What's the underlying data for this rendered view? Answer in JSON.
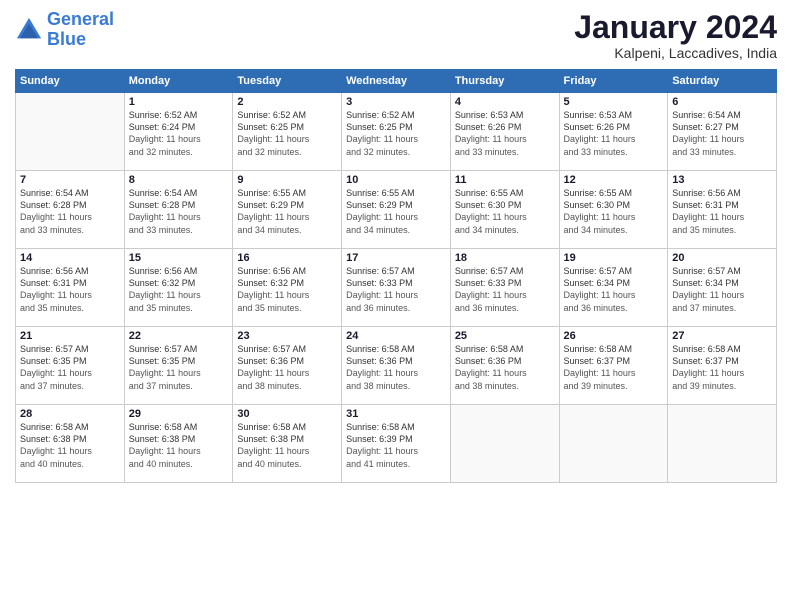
{
  "logo": {
    "line1": "General",
    "line2": "Blue"
  },
  "title": "January 2024",
  "location": "Kalpeni, Laccadives, India",
  "days_of_week": [
    "Sunday",
    "Monday",
    "Tuesday",
    "Wednesday",
    "Thursday",
    "Friday",
    "Saturday"
  ],
  "weeks": [
    [
      {
        "day": "",
        "sunrise": "",
        "sunset": "",
        "daylight": ""
      },
      {
        "day": "1",
        "sunrise": "Sunrise: 6:52 AM",
        "sunset": "Sunset: 6:24 PM",
        "daylight": "Daylight: 11 hours and 32 minutes."
      },
      {
        "day": "2",
        "sunrise": "Sunrise: 6:52 AM",
        "sunset": "Sunset: 6:25 PM",
        "daylight": "Daylight: 11 hours and 32 minutes."
      },
      {
        "day": "3",
        "sunrise": "Sunrise: 6:52 AM",
        "sunset": "Sunset: 6:25 PM",
        "daylight": "Daylight: 11 hours and 32 minutes."
      },
      {
        "day": "4",
        "sunrise": "Sunrise: 6:53 AM",
        "sunset": "Sunset: 6:26 PM",
        "daylight": "Daylight: 11 hours and 33 minutes."
      },
      {
        "day": "5",
        "sunrise": "Sunrise: 6:53 AM",
        "sunset": "Sunset: 6:26 PM",
        "daylight": "Daylight: 11 hours and 33 minutes."
      },
      {
        "day": "6",
        "sunrise": "Sunrise: 6:54 AM",
        "sunset": "Sunset: 6:27 PM",
        "daylight": "Daylight: 11 hours and 33 minutes."
      }
    ],
    [
      {
        "day": "7",
        "sunrise": "Sunrise: 6:54 AM",
        "sunset": "Sunset: 6:28 PM",
        "daylight": "Daylight: 11 hours and 33 minutes."
      },
      {
        "day": "8",
        "sunrise": "Sunrise: 6:54 AM",
        "sunset": "Sunset: 6:28 PM",
        "daylight": "Daylight: 11 hours and 33 minutes."
      },
      {
        "day": "9",
        "sunrise": "Sunrise: 6:55 AM",
        "sunset": "Sunset: 6:29 PM",
        "daylight": "Daylight: 11 hours and 34 minutes."
      },
      {
        "day": "10",
        "sunrise": "Sunrise: 6:55 AM",
        "sunset": "Sunset: 6:29 PM",
        "daylight": "Daylight: 11 hours and 34 minutes."
      },
      {
        "day": "11",
        "sunrise": "Sunrise: 6:55 AM",
        "sunset": "Sunset: 6:30 PM",
        "daylight": "Daylight: 11 hours and 34 minutes."
      },
      {
        "day": "12",
        "sunrise": "Sunrise: 6:55 AM",
        "sunset": "Sunset: 6:30 PM",
        "daylight": "Daylight: 11 hours and 34 minutes."
      },
      {
        "day": "13",
        "sunrise": "Sunrise: 6:56 AM",
        "sunset": "Sunset: 6:31 PM",
        "daylight": "Daylight: 11 hours and 35 minutes."
      }
    ],
    [
      {
        "day": "14",
        "sunrise": "Sunrise: 6:56 AM",
        "sunset": "Sunset: 6:31 PM",
        "daylight": "Daylight: 11 hours and 35 minutes."
      },
      {
        "day": "15",
        "sunrise": "Sunrise: 6:56 AM",
        "sunset": "Sunset: 6:32 PM",
        "daylight": "Daylight: 11 hours and 35 minutes."
      },
      {
        "day": "16",
        "sunrise": "Sunrise: 6:56 AM",
        "sunset": "Sunset: 6:32 PM",
        "daylight": "Daylight: 11 hours and 35 minutes."
      },
      {
        "day": "17",
        "sunrise": "Sunrise: 6:57 AM",
        "sunset": "Sunset: 6:33 PM",
        "daylight": "Daylight: 11 hours and 36 minutes."
      },
      {
        "day": "18",
        "sunrise": "Sunrise: 6:57 AM",
        "sunset": "Sunset: 6:33 PM",
        "daylight": "Daylight: 11 hours and 36 minutes."
      },
      {
        "day": "19",
        "sunrise": "Sunrise: 6:57 AM",
        "sunset": "Sunset: 6:34 PM",
        "daylight": "Daylight: 11 hours and 36 minutes."
      },
      {
        "day": "20",
        "sunrise": "Sunrise: 6:57 AM",
        "sunset": "Sunset: 6:34 PM",
        "daylight": "Daylight: 11 hours and 37 minutes."
      }
    ],
    [
      {
        "day": "21",
        "sunrise": "Sunrise: 6:57 AM",
        "sunset": "Sunset: 6:35 PM",
        "daylight": "Daylight: 11 hours and 37 minutes."
      },
      {
        "day": "22",
        "sunrise": "Sunrise: 6:57 AM",
        "sunset": "Sunset: 6:35 PM",
        "daylight": "Daylight: 11 hours and 37 minutes."
      },
      {
        "day": "23",
        "sunrise": "Sunrise: 6:57 AM",
        "sunset": "Sunset: 6:36 PM",
        "daylight": "Daylight: 11 hours and 38 minutes."
      },
      {
        "day": "24",
        "sunrise": "Sunrise: 6:58 AM",
        "sunset": "Sunset: 6:36 PM",
        "daylight": "Daylight: 11 hours and 38 minutes."
      },
      {
        "day": "25",
        "sunrise": "Sunrise: 6:58 AM",
        "sunset": "Sunset: 6:36 PM",
        "daylight": "Daylight: 11 hours and 38 minutes."
      },
      {
        "day": "26",
        "sunrise": "Sunrise: 6:58 AM",
        "sunset": "Sunset: 6:37 PM",
        "daylight": "Daylight: 11 hours and 39 minutes."
      },
      {
        "day": "27",
        "sunrise": "Sunrise: 6:58 AM",
        "sunset": "Sunset: 6:37 PM",
        "daylight": "Daylight: 11 hours and 39 minutes."
      }
    ],
    [
      {
        "day": "28",
        "sunrise": "Sunrise: 6:58 AM",
        "sunset": "Sunset: 6:38 PM",
        "daylight": "Daylight: 11 hours and 40 minutes."
      },
      {
        "day": "29",
        "sunrise": "Sunrise: 6:58 AM",
        "sunset": "Sunset: 6:38 PM",
        "daylight": "Daylight: 11 hours and 40 minutes."
      },
      {
        "day": "30",
        "sunrise": "Sunrise: 6:58 AM",
        "sunset": "Sunset: 6:38 PM",
        "daylight": "Daylight: 11 hours and 40 minutes."
      },
      {
        "day": "31",
        "sunrise": "Sunrise: 6:58 AM",
        "sunset": "Sunset: 6:39 PM",
        "daylight": "Daylight: 11 hours and 41 minutes."
      },
      {
        "day": "",
        "sunrise": "",
        "sunset": "",
        "daylight": ""
      },
      {
        "day": "",
        "sunrise": "",
        "sunset": "",
        "daylight": ""
      },
      {
        "day": "",
        "sunrise": "",
        "sunset": "",
        "daylight": ""
      }
    ]
  ]
}
